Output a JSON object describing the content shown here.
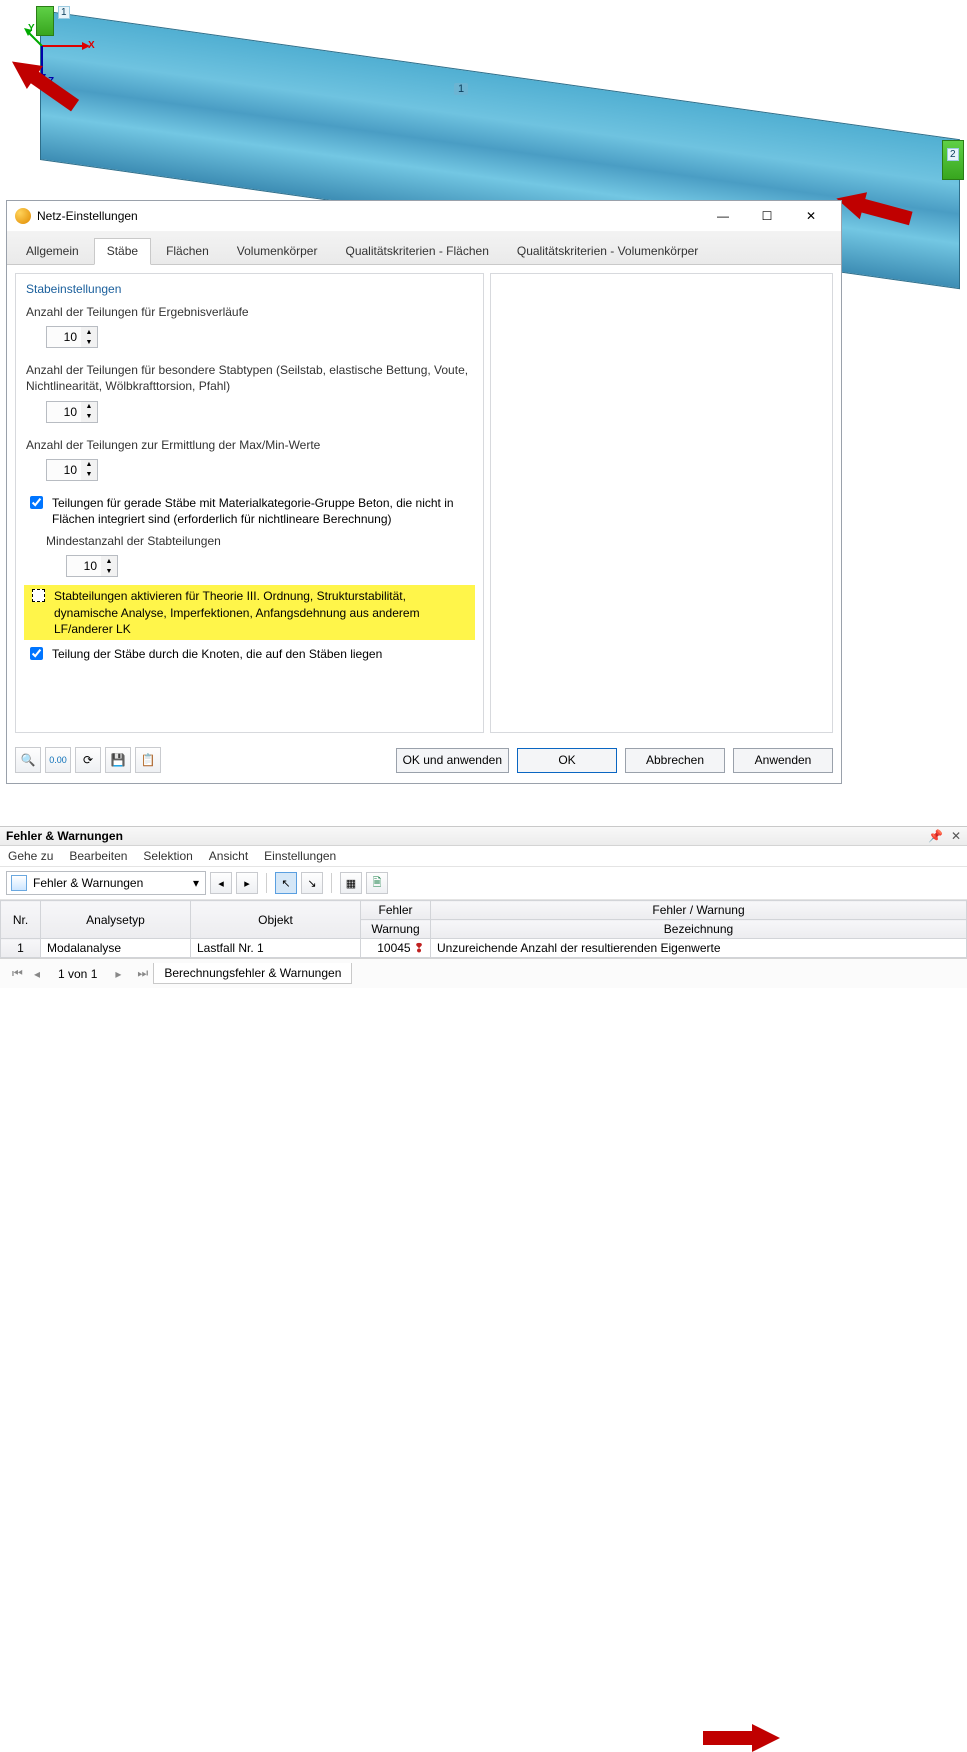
{
  "viewport": {
    "member_label": "1",
    "node_left": "1",
    "node_right": "2",
    "axes": {
      "x": "X",
      "y": "Y",
      "z": "Z"
    }
  },
  "dialog": {
    "title": "Netz-Einstellungen",
    "tabs": [
      "Allgemein",
      "Stäbe",
      "Flächen",
      "Volumenkörper",
      "Qualitätskriterien - Flächen",
      "Qualitätskriterien - Volumenkörper"
    ],
    "active_tab_index": 1,
    "section_title": "Stabeinstellungen",
    "fields": {
      "result_div": {
        "label": "Anzahl der Teilungen für Ergebnisverläufe",
        "value": "10"
      },
      "special_div": {
        "label": "Anzahl der Teilungen für besondere Stabtypen (Seilstab, elastische Bettung, Voute, Nichtlinearität, Wölbkrafttorsion, Pfahl)",
        "value": "10"
      },
      "maxmin_div": {
        "label": "Anzahl der Teilungen zur Ermittlung der Max/Min-Werte",
        "value": "10"
      },
      "concrete_check": {
        "label": "Teilungen für gerade Stäbe mit Materialkategorie-Gruppe Beton, die nicht in Flächen integriert sind (erforderlich für nichtlineare Berechnung)",
        "sublabel": "Mindestanzahl der Stabteilungen",
        "value": "10"
      },
      "highlight_check": "Stabteilungen aktivieren für Theorie III. Ordnung, Strukturstabilität, dynamische Analyse, Imperfektionen, Anfangsdehnung aus anderem LF/anderer LK",
      "nodes_check": "Teilung der Stäbe durch die Knoten, die auf den Stäben liegen"
    },
    "buttons": {
      "ok_apply": "OK und anwenden",
      "ok": "OK",
      "cancel": "Abbrechen",
      "apply": "Anwenden"
    },
    "tool_icons": [
      "🔍",
      "0.00",
      "⟳",
      "💾",
      "📋"
    ]
  },
  "errors_panel": {
    "title": "Fehler & Warnungen",
    "menus": [
      "Gehe zu",
      "Bearbeiten",
      "Selektion",
      "Ansicht",
      "Einstellungen"
    ],
    "dropdown_label": "Fehler & Warnungen",
    "columns": {
      "nr": "Nr.",
      "analysetype": "Analysetyp",
      "objekt": "Objekt",
      "fehler_group": "Fehler",
      "warnung": "Warnung",
      "fwgroup": "Fehler / Warnung",
      "bez": "Bezeichnung"
    },
    "row": {
      "nr": "1",
      "analysetype": "Modalanalyse",
      "objekt": "Lastfall Nr. 1",
      "code": "10045",
      "bez": "Unzureichende Anzahl der resultierenden Eigenwerte"
    },
    "footer": {
      "pos": "1 von 1",
      "tab": "Berechnungsfehler & Warnungen"
    },
    "pin_icon": "📌",
    "close_icon": "✕"
  }
}
